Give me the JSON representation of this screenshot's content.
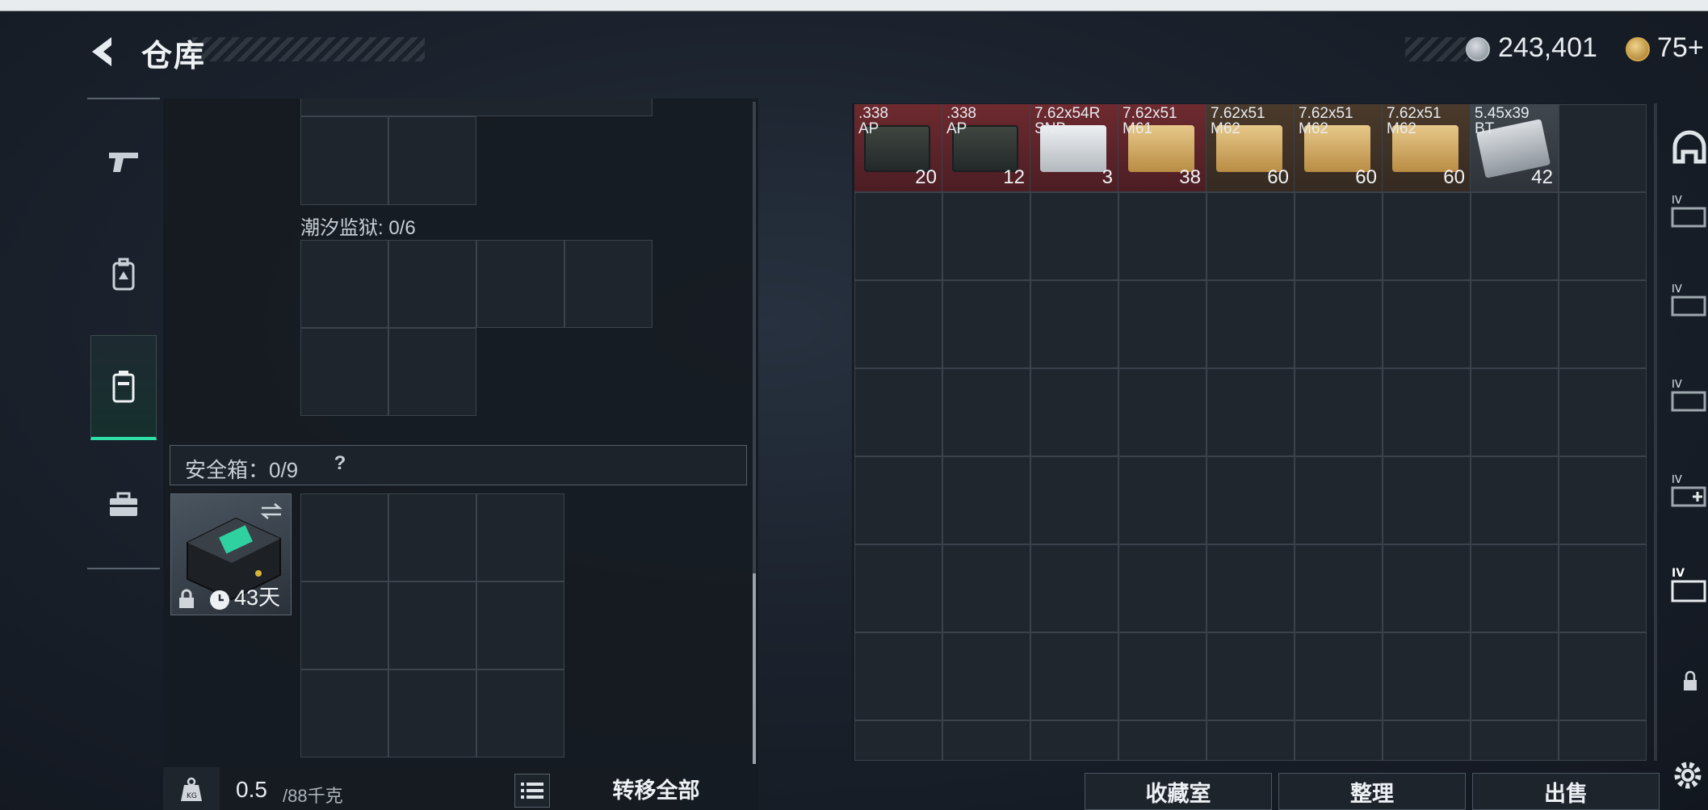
{
  "header": {
    "title": "仓库",
    "currency_primary": "243,401",
    "currency_secondary": "75+"
  },
  "nav": {
    "items": [
      {
        "name": "weapons",
        "icon": "pistol-icon"
      },
      {
        "name": "gear",
        "icon": "backpack-icon"
      },
      {
        "name": "containers",
        "icon": "container-icon",
        "active": true
      },
      {
        "name": "toolbox",
        "icon": "toolbox-icon"
      }
    ]
  },
  "left_panel": {
    "section_label": "潮汐监狱: 0/6",
    "safebox_label": "安全箱：0/9",
    "safebox_help": "?",
    "safebox_timer": "43天",
    "weight_value": "0.5",
    "weight_max": "/88千克",
    "transfer_all": "转移全部"
  },
  "stash": {
    "items": [
      {
        "name": ".338\nAP",
        "count": "20",
        "tint": "red",
        "box": "ap"
      },
      {
        "name": ".338\nAP",
        "count": "12",
        "tint": "red",
        "box": "ap"
      },
      {
        "name": "7.62x54R\nSNB",
        "count": "3",
        "tint": "red",
        "box": "snb"
      },
      {
        "name": "7.62x51\nM61",
        "count": "38",
        "tint": "red",
        "box": "m"
      },
      {
        "name": "7.62x51\nM62",
        "count": "60",
        "tint": "brown",
        "box": "m"
      },
      {
        "name": "7.62x51\nM62",
        "count": "60",
        "tint": "brown",
        "box": "m"
      },
      {
        "name": "7.62x51\nM62",
        "count": "60",
        "tint": "brown",
        "box": "m"
      },
      {
        "name": "5.45x39\nBT",
        "count": "42",
        "tint": "grey",
        "box": "bt"
      }
    ]
  },
  "bottom_buttons": {
    "collection": "收藏室",
    "sort": "整理",
    "sell": "出售"
  },
  "colors": {
    "accent": "#2fe0a6",
    "red_tint": "#6e2a2f",
    "brown_tint": "#4a3a2b"
  }
}
